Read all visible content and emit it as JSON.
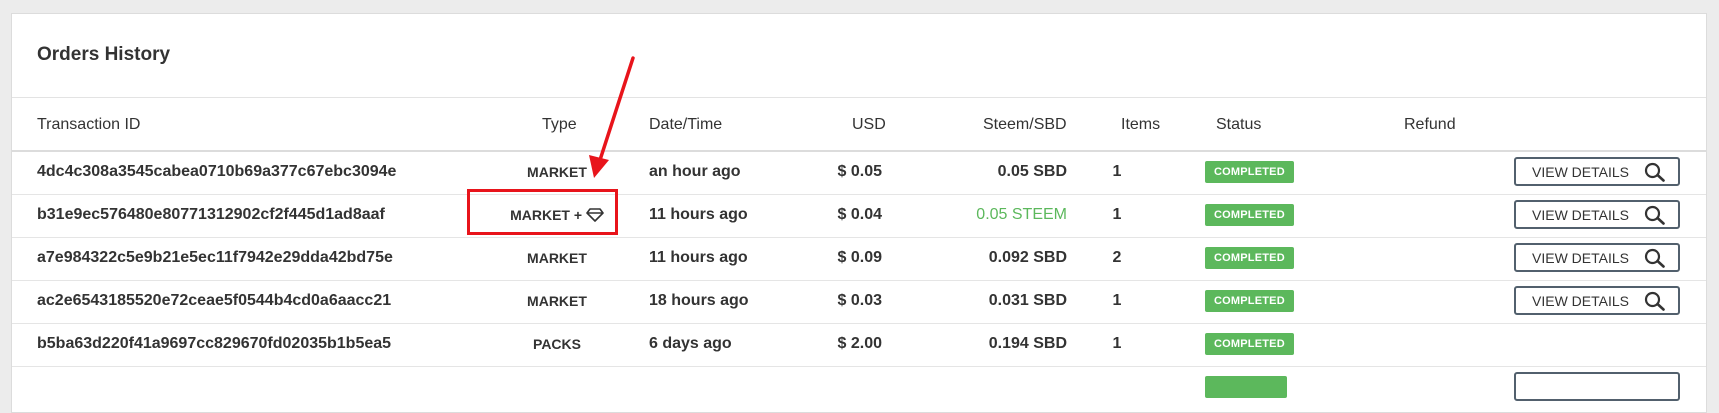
{
  "title": "Orders History",
  "columns": {
    "txid": "Transaction ID",
    "type": "Type",
    "datetime": "Date/Time",
    "usd": "USD",
    "steem": "Steem/SBD",
    "items": "Items",
    "status": "Status",
    "refund": "Refund"
  },
  "rows": [
    {
      "txid": "4dc4c308a3545cabea0710b69a377c67ebc3094e",
      "type": "MARKET",
      "date": "an hour ago",
      "usd": "$ 0.05",
      "steem": "0.05 SBD",
      "items": "1",
      "status": "COMPLETED",
      "view": "VIEW DETAILS"
    },
    {
      "txid": "b31e9ec576480e80771312902cf2f445d1ad8aaf",
      "type": "MARKET +",
      "date": "11 hours ago",
      "usd": "$ 0.04",
      "steem": "0.05 STEEM",
      "items": "1",
      "status": "COMPLETED",
      "view": "VIEW DETAILS"
    },
    {
      "txid": "a7e984322c5e9b21e5ec11f7942e29dda42bd75e",
      "type": "MARKET",
      "date": "11 hours ago",
      "usd": "$ 0.09",
      "steem": "0.092 SBD",
      "items": "2",
      "status": "COMPLETED",
      "view": "VIEW DETAILS"
    },
    {
      "txid": "ac2e6543185520e72ceae5f0544b4cd0a6aacc21",
      "type": "MARKET",
      "date": "18 hours ago",
      "usd": "$ 0.03",
      "steem": "0.031 SBD",
      "items": "1",
      "status": "COMPLETED",
      "view": "VIEW DETAILS"
    },
    {
      "txid": "b5ba63d220f41a9697cc829670fd02035b1b5ea5",
      "type": "PACKS",
      "date": "6 days ago",
      "usd": "$ 2.00",
      "steem": "0.194 SBD",
      "items": "1",
      "status": "COMPLETED"
    }
  ],
  "colors": {
    "completed": "#5cb85c",
    "steem_value": "#5cb85c",
    "annotation": "#e8141b",
    "button_border": "#52606d"
  },
  "icons": {
    "view": "search-icon",
    "gem": "diamond-icon"
  }
}
